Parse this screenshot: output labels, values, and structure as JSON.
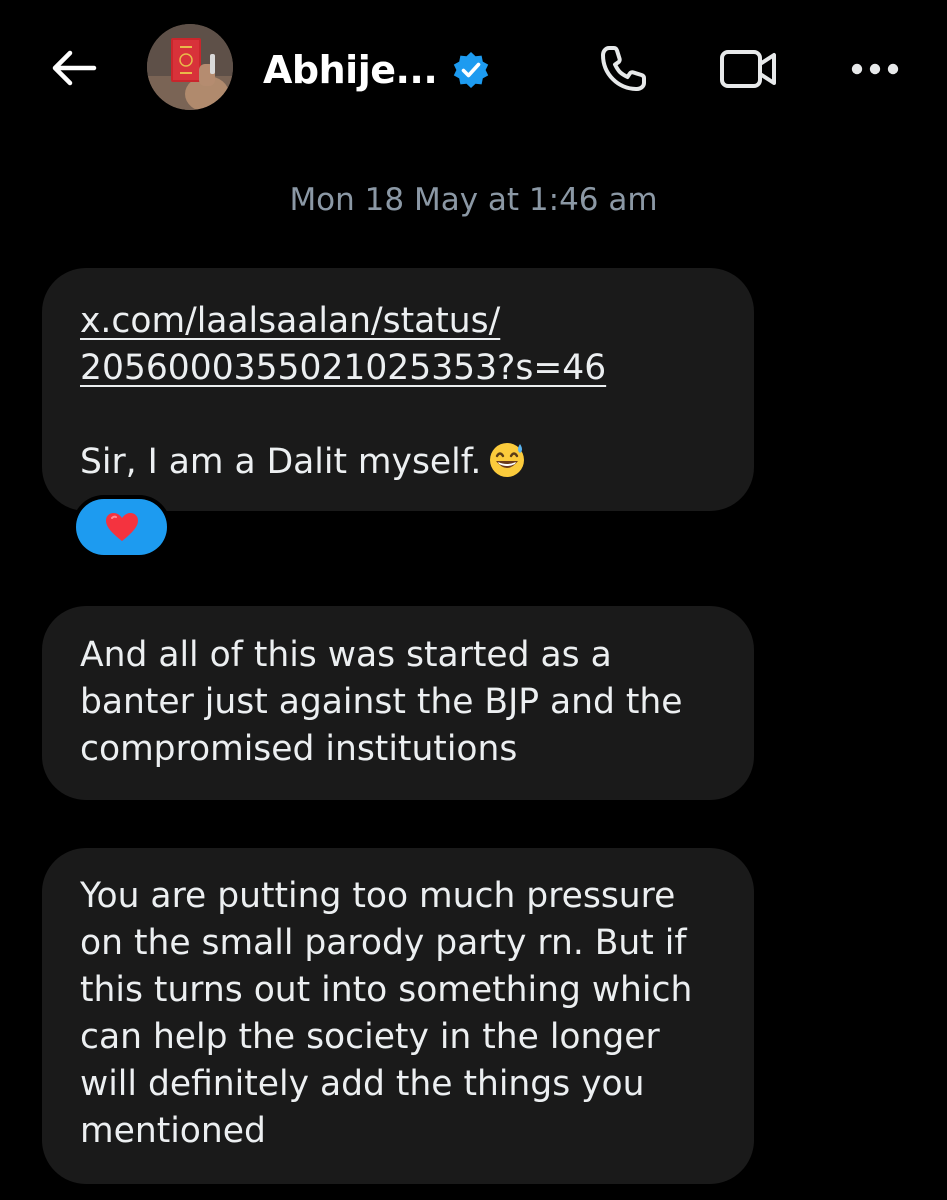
{
  "header": {
    "title": "Abhije...",
    "verified": true,
    "icons": [
      "back-arrow-icon",
      "phone-icon",
      "video-icon",
      "more-icon"
    ]
  },
  "conversation": {
    "timestamp": "Mon 18 May at 1:46 am",
    "messages": [
      {
        "link_line1": "x.com/laalsaalan/status/",
        "link_line2": "2056000355021025353?s=46",
        "text": "Sir, I am a Dalit myself.",
        "emoji": "grinning-sweat-emoji",
        "reaction": "red-heart-emoji"
      },
      {
        "text": "And all of this was started as a banter just against the BJP and the compromised institutions"
      },
      {
        "text": "You are putting too much pressure on the small parody party rn. But if this turns out into something which can help the society in the longer will definitely add the things you mentioned"
      }
    ]
  },
  "colors": {
    "background": "#000000",
    "bubble": "#1a1a1a",
    "accent": "#1d9bf0",
    "secondary_text": "#8b98a5"
  }
}
